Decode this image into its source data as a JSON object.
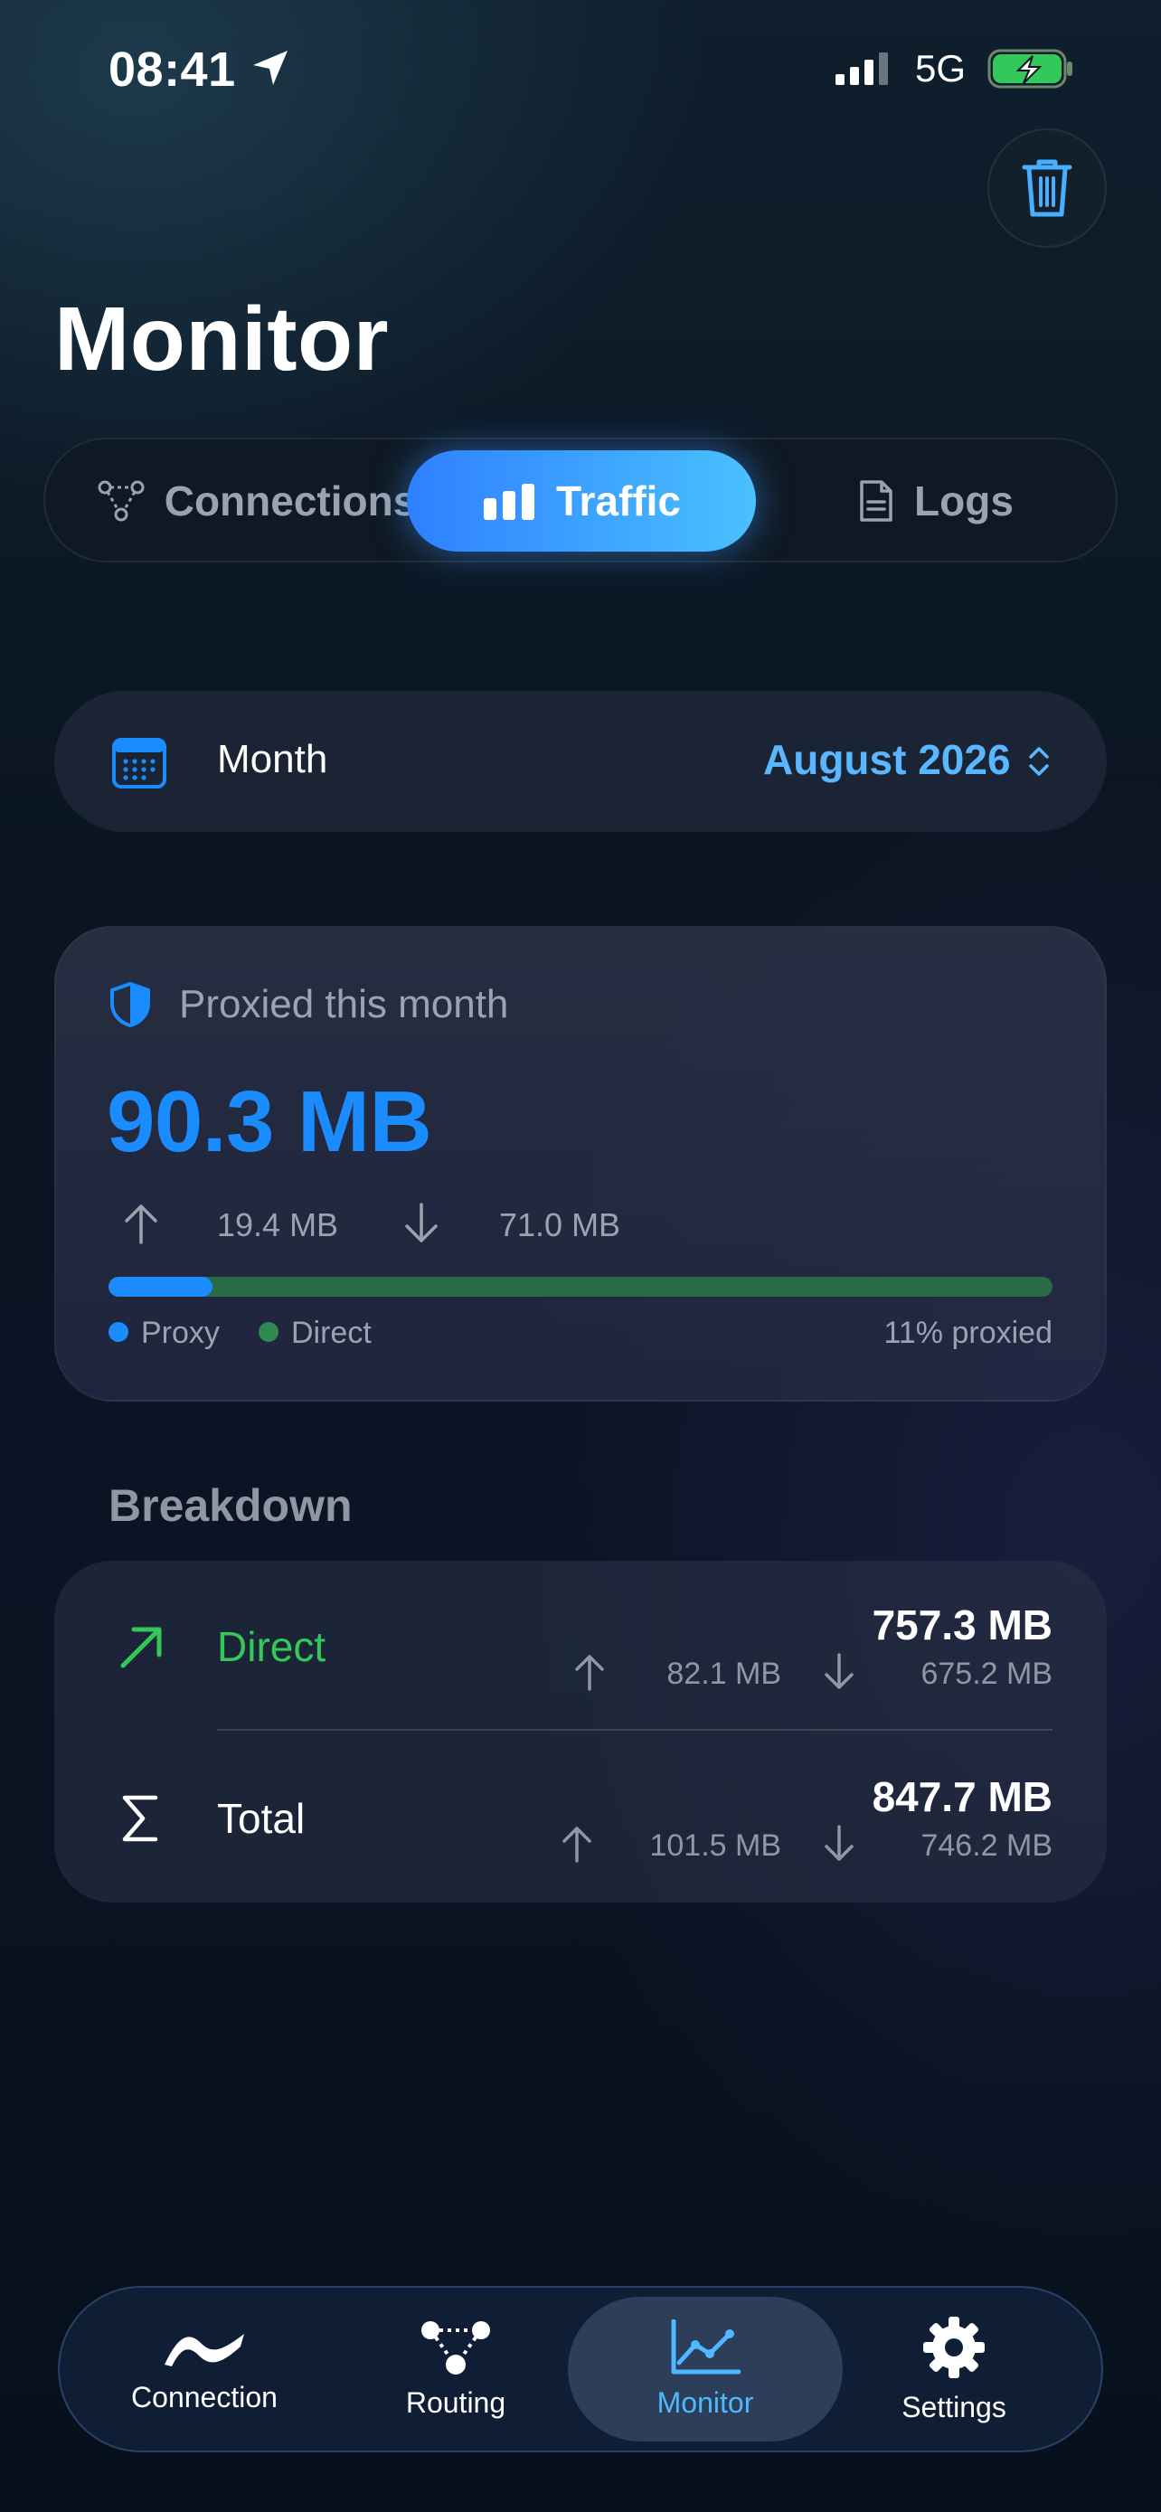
{
  "status_bar": {
    "time": "08:41",
    "network": "5G",
    "icons": [
      "location-arrow-icon",
      "signal-icon",
      "battery-charging-icon"
    ]
  },
  "header": {
    "title": "Monitor",
    "trash_icon": "trash-icon"
  },
  "segments": {
    "items": [
      {
        "label": "Connections",
        "icon": "nodes-icon"
      },
      {
        "label": "Traffic",
        "icon": "bar-chart-icon",
        "selected": true
      },
      {
        "label": "Logs",
        "icon": "document-icon"
      }
    ]
  },
  "period": {
    "label": "Month",
    "value": "August 2026",
    "icon": "calendar-icon"
  },
  "proxied": {
    "heading": "Proxied this month",
    "total": "90.3 MB",
    "upload": "19.4 MB",
    "download": "71.0 MB",
    "proxy_fraction": 0.11,
    "legend_proxy": "Proxy",
    "legend_direct": "Direct",
    "percent_text": "11% proxied",
    "colors": {
      "proxy": "#1a8cff",
      "direct": "#2f8a52"
    }
  },
  "breakdown": {
    "title": "Breakdown",
    "rows": [
      {
        "label": "Direct",
        "total": "757.3 MB",
        "upload": "82.1 MB",
        "download": "675.2 MB",
        "icon": "arrow-up-right-icon",
        "color": "#34c759"
      },
      {
        "label": "Total",
        "total": "847.7 MB",
        "upload": "101.5 MB",
        "download": "746.2 MB",
        "icon": "sigma-icon",
        "color": "#ffffff"
      }
    ]
  },
  "tabbar": {
    "items": [
      {
        "label": "Connection",
        "icon": "wave-icon"
      },
      {
        "label": "Routing",
        "icon": "routing-icon"
      },
      {
        "label": "Monitor",
        "icon": "line-chart-icon",
        "selected": true
      },
      {
        "label": "Settings",
        "icon": "gear-icon"
      }
    ],
    "accent": "#4fb8ff"
  }
}
